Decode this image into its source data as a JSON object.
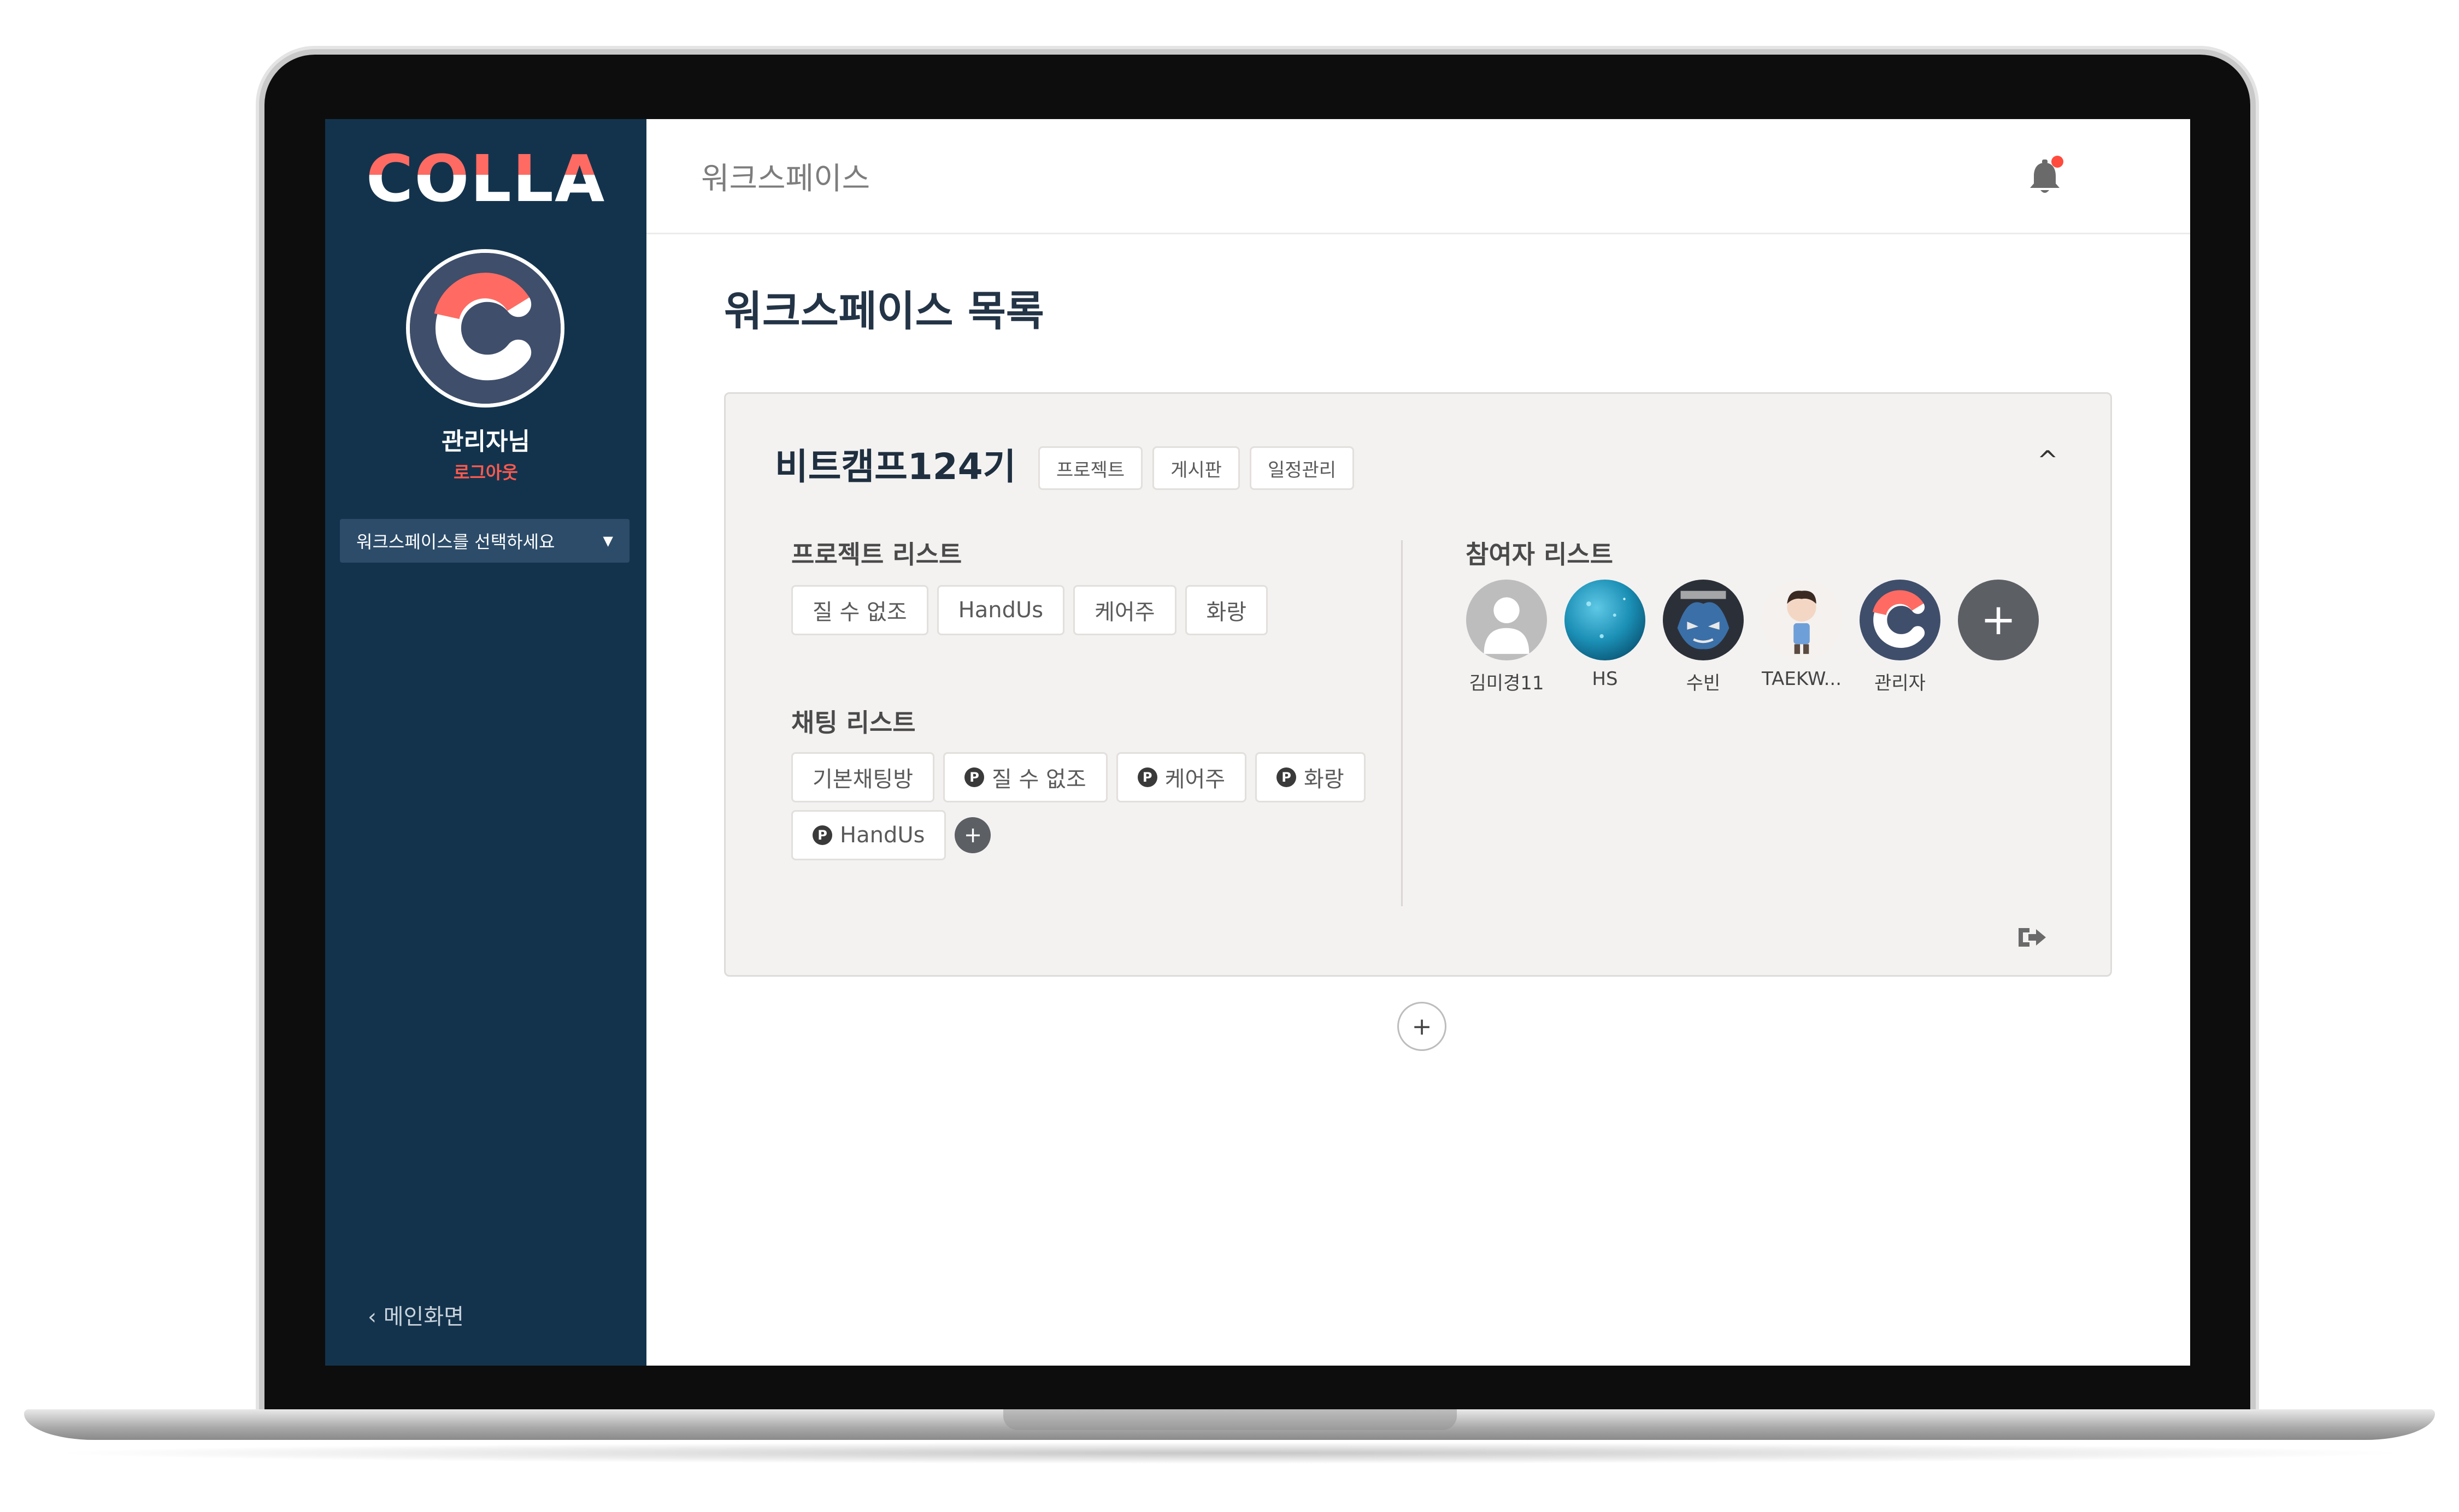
{
  "sidebar": {
    "logo": "COLLA",
    "user_name": "관리자님",
    "logout": "로그아웃",
    "workspace_select": "워크스페이스를 선택하세요",
    "main_link": "메인화면",
    "accent": "#ff6b62",
    "bg": "#13334d"
  },
  "topbar": {
    "title": "워크스페이스",
    "notification_dot_color": "#ff4b3e"
  },
  "page": {
    "title": "워크스페이스 목록"
  },
  "workspace": {
    "name": "비트캠프124기",
    "tabs": [
      "프로젝트",
      "게시판",
      "일정관리"
    ],
    "project_section": "프로젝트 리스트",
    "projects": [
      "질 수 없조",
      "HandUs",
      "케어주",
      "화랑"
    ],
    "chat_section": "채팅 리스트",
    "chats": [
      {
        "label": "기본채팅방",
        "badge": ""
      },
      {
        "label": "질 수 없조",
        "badge": "P"
      },
      {
        "label": "케어주",
        "badge": "P"
      },
      {
        "label": "화랑",
        "badge": "P"
      },
      {
        "label": "HandUs",
        "badge": "P"
      }
    ],
    "members_section": "참여자 리스트",
    "members": [
      "김미경11",
      "HS",
      "수빈",
      "TAEKW...",
      "관리자"
    ]
  },
  "icons": {
    "collapse": "chevron-up-icon",
    "add": "plus-icon",
    "exit": "sign-out-icon",
    "bell": "bell-icon"
  }
}
